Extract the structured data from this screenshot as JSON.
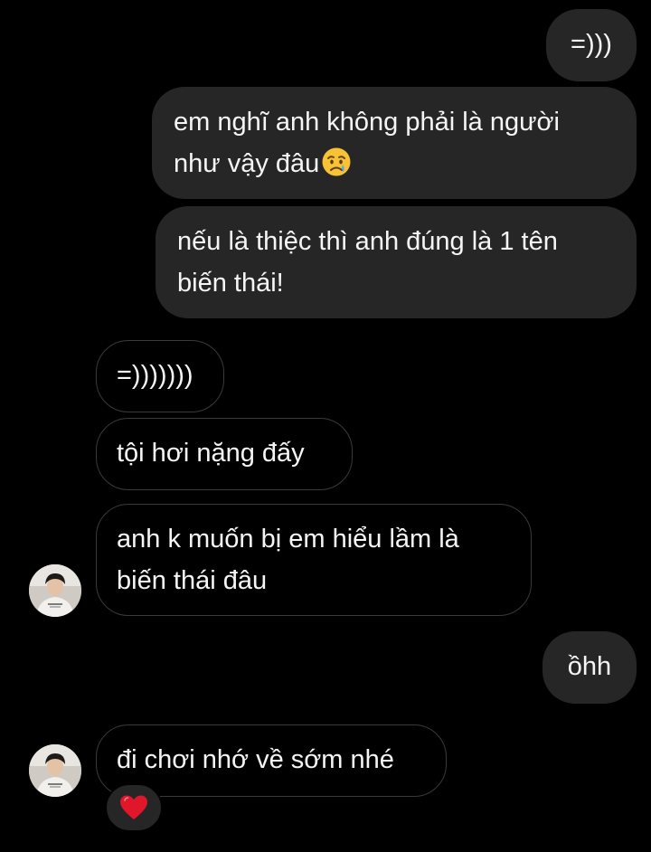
{
  "conversation": {
    "messages": [
      {
        "direction": "sent",
        "lines": [
          "=)))"
        ]
      },
      {
        "direction": "sent",
        "lines": [
          "em nghĩ anh không phải là người",
          "như vậy đâu"
        ],
        "trailing_emoji": "crying-face-emoji"
      },
      {
        "direction": "sent",
        "lines": [
          "nếu là thiệc thì anh đúng là 1 tên",
          "biến thái!"
        ]
      },
      {
        "direction": "received",
        "lines": [
          "=)))))))"
        ]
      },
      {
        "direction": "received",
        "lines": [
          "tội hơi nặng đấy"
        ]
      },
      {
        "direction": "received",
        "lines": [
          "anh k muốn bị em hiểu lầm là",
          "biến thái đâu"
        ]
      },
      {
        "direction": "sent",
        "lines": [
          "ồhh"
        ]
      },
      {
        "direction": "received",
        "lines": [
          "đi chơi nhớ về sớm nhé"
        ],
        "reaction": "red-heart-emoji"
      }
    ]
  },
  "colors": {
    "background": "#000000",
    "sent_bubble": "#262626",
    "received_border": "#3a3a3a",
    "text": "#f5f5f5",
    "heart": "#e0162b"
  }
}
